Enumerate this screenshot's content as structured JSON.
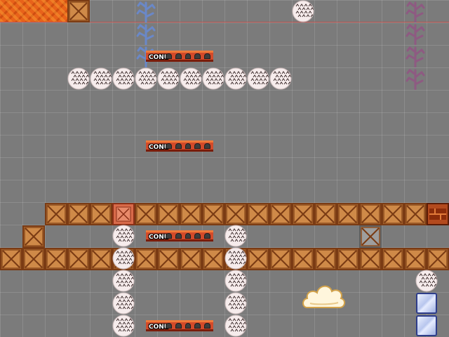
{
  "scene": {
    "title": "",
    "conveyor_label": "CONU",
    "colors": {
      "background": "#7b7b7b",
      "crate": "#cf8a48",
      "conveyor": "#d24a2a",
      "lava": "#e8621a"
    }
  },
  "conveyors": [
    {
      "label": "CONU"
    },
    {
      "label": "CONU"
    },
    {
      "label": "CONU"
    },
    {
      "label": "CONU"
    }
  ],
  "icons": {
    "crate": "crate-icon",
    "ball": "spiky-ball-icon",
    "coral_blue": "blue-coral-icon",
    "coral_purple": "purple-coral-icon",
    "cloud": "cloud-icon",
    "ice_block": "ice-block-icon"
  }
}
